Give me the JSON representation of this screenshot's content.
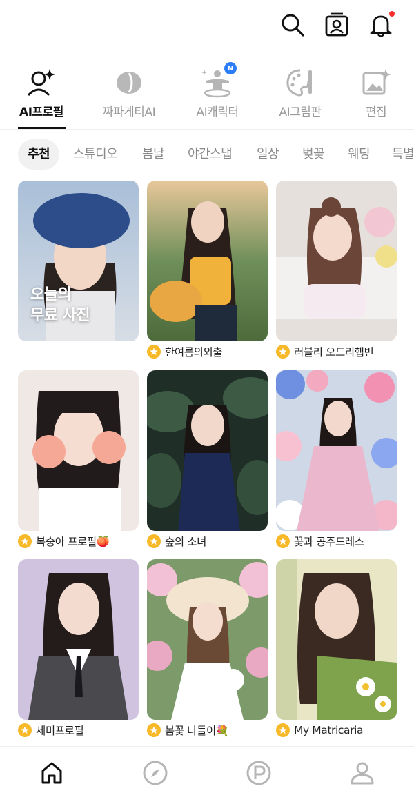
{
  "colors": {
    "accent_red": "#ff2d2d",
    "accent_blue": "#2c7df7",
    "star_yellow": "#f7b928",
    "active_text": "#111111",
    "inactive_text": "#9a9a9a"
  },
  "header": {
    "icons": [
      "search-icon",
      "profile-card-icon",
      "bell-icon"
    ],
    "has_notification": true
  },
  "feature_tabs": [
    {
      "label": "AI프로필",
      "icon": "person-sparkle-icon",
      "active": true
    },
    {
      "label": "짜파게티AI",
      "icon": "bowl-icon",
      "active": false
    },
    {
      "label": "AI캐릭터",
      "icon": "character-icon",
      "active": false,
      "badge": "N"
    },
    {
      "label": "AI그림판",
      "icon": "palette-brush-icon",
      "active": false
    },
    {
      "label": "편집",
      "icon": "image-edit-icon",
      "active": false
    }
  ],
  "chips": [
    "추천",
    "스튜디오",
    "봄날",
    "야간스냅",
    "일상",
    "벚꽃",
    "웨딩",
    "특별"
  ],
  "cards": [
    {
      "overlay": "오늘의\n무료 사진",
      "caption": ""
    },
    {
      "caption": "한여름의외출"
    },
    {
      "caption": "러블리 오드리햅번"
    },
    {
      "caption": "복숭아 프로필🍑"
    },
    {
      "caption": "숲의 소녀"
    },
    {
      "caption": "꽃과 공주드레스"
    },
    {
      "caption": "세미프로필"
    },
    {
      "caption": "봄꽃 나들이💐"
    },
    {
      "caption": "My Matricaria"
    }
  ],
  "bottom_nav": [
    {
      "icon": "home-icon",
      "active": true
    },
    {
      "icon": "compass-icon",
      "active": false
    },
    {
      "icon": "point-icon",
      "active": false
    },
    {
      "icon": "person-icon",
      "active": false
    }
  ]
}
